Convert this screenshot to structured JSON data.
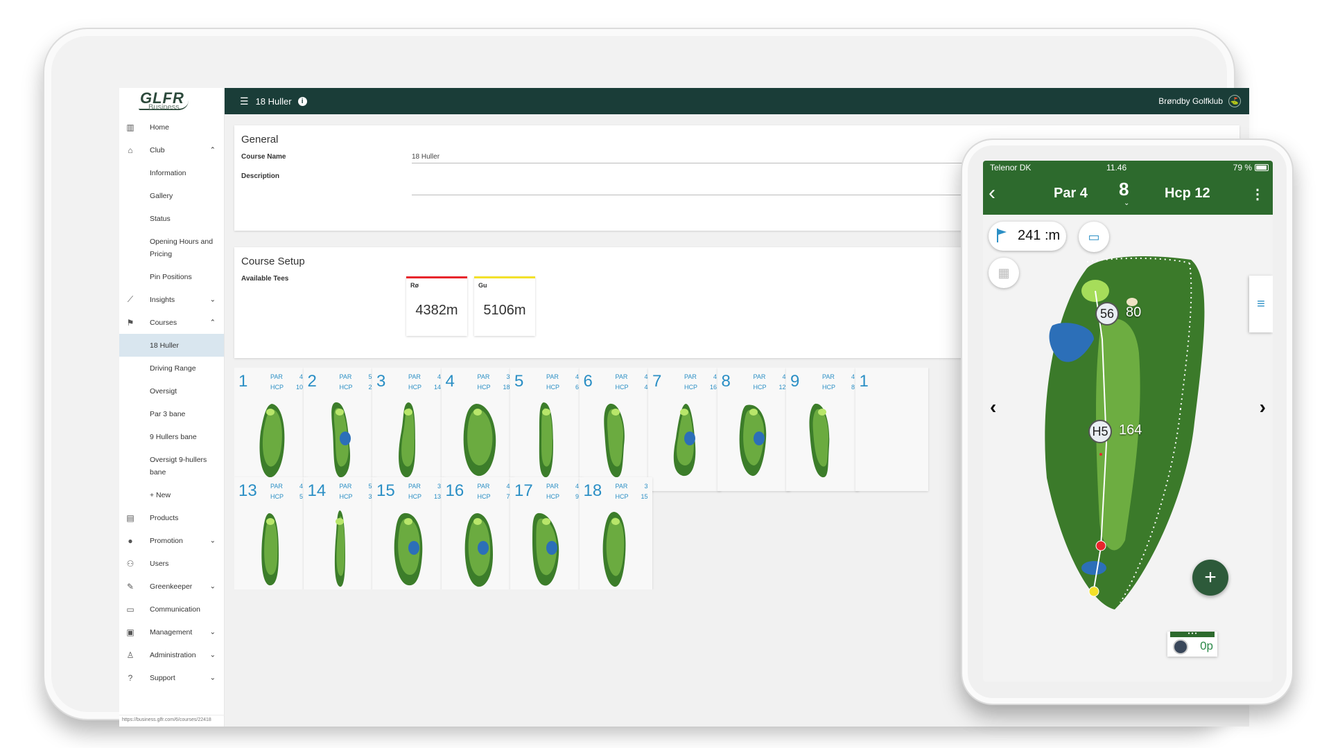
{
  "app": {
    "logo_text": "GLFR",
    "logo_sub": "Business",
    "topbar_title": "18 Huller",
    "club_name": "Brøndby Golfklub",
    "url": "https://business.glfr.com/6/courses/22418"
  },
  "sidebar": {
    "items": [
      {
        "label": "Home",
        "icon": "building-icon",
        "chev": ""
      },
      {
        "label": "Club",
        "icon": "bank-icon",
        "chev": "^"
      },
      {
        "label": "Information",
        "sub": true
      },
      {
        "label": "Gallery",
        "sub": true
      },
      {
        "label": "Status",
        "sub": true
      },
      {
        "label": "Opening Hours and Pricing",
        "sub": true,
        "tall": true
      },
      {
        "label": "Pin Positions",
        "sub": true
      },
      {
        "label": "Insights",
        "icon": "chart-icon",
        "chev": "v"
      },
      {
        "label": "Courses",
        "icon": "golf-flag-icon",
        "chev": "^"
      },
      {
        "label": "18 Huller",
        "sub": true,
        "active": true
      },
      {
        "label": "Driving Range",
        "sub": true
      },
      {
        "label": "Oversigt",
        "sub": true
      },
      {
        "label": "Par 3 bane",
        "sub": true
      },
      {
        "label": "9 Hullers bane",
        "sub": true
      },
      {
        "label": "Oversigt 9-hullers bane",
        "sub": true,
        "tall": true
      },
      {
        "label": "+ New",
        "sub": true
      },
      {
        "label": "Products",
        "icon": "products-icon",
        "chev": ""
      },
      {
        "label": "Promotion",
        "icon": "promotion-icon",
        "chev": "v"
      },
      {
        "label": "Users",
        "icon": "users-icon",
        "chev": ""
      },
      {
        "label": "Greenkeeper",
        "icon": "wrench-icon",
        "chev": "v"
      },
      {
        "label": "Communication",
        "icon": "chat-icon",
        "chev": ""
      },
      {
        "label": "Management",
        "icon": "clipboard-icon",
        "chev": "v"
      },
      {
        "label": "Administration",
        "icon": "person-icon",
        "chev": "v"
      },
      {
        "label": "Support",
        "icon": "help-icon",
        "chev": "v"
      }
    ]
  },
  "general": {
    "heading": "General",
    "course_name_label": "Course Name",
    "course_name_value": "18 Huller",
    "description_label": "Description"
  },
  "setup": {
    "heading": "Course Setup",
    "tees_label": "Available Tees",
    "tees": [
      {
        "name": "Rø",
        "length": "4382m",
        "color": "#e8262c"
      },
      {
        "name": "Gu",
        "length": "5106m",
        "color": "#f3e12a"
      }
    ]
  },
  "holes": {
    "par_label": "PAR",
    "hcp_label": "HCP",
    "list": [
      {
        "no": "1",
        "par": "4",
        "hcp": "10"
      },
      {
        "no": "2",
        "par": "5",
        "hcp": "2"
      },
      {
        "no": "3",
        "par": "4",
        "hcp": "14"
      },
      {
        "no": "4",
        "par": "3",
        "hcp": "18"
      },
      {
        "no": "5",
        "par": "4",
        "hcp": "6"
      },
      {
        "no": "6",
        "par": "4",
        "hcp": "4"
      },
      {
        "no": "7",
        "par": "4",
        "hcp": "16"
      },
      {
        "no": "8",
        "par": "4",
        "hcp": "12"
      },
      {
        "no": "9",
        "par": "4",
        "hcp": "8"
      },
      {
        "no": "1",
        "par": "",
        "hcp": ""
      },
      {
        "no": "13",
        "par": "4",
        "hcp": "5"
      },
      {
        "no": "14",
        "par": "5",
        "hcp": "3"
      },
      {
        "no": "15",
        "par": "3",
        "hcp": "13"
      },
      {
        "no": "16",
        "par": "4",
        "hcp": "7"
      },
      {
        "no": "17",
        "par": "4",
        "hcp": "9"
      },
      {
        "no": "18",
        "par": "3",
        "hcp": "15"
      }
    ]
  },
  "phone": {
    "carrier": "Telenor DK",
    "time": "11.46",
    "battery": "79 %",
    "par": "Par 4",
    "hole": "8",
    "hcp": "Hcp 12",
    "distance": "241",
    "distance_unit": ":m",
    "marker_top": "56",
    "marker_top_dist": "80",
    "marker_mid": "H5",
    "marker_mid_dist": "164",
    "points": "0p",
    "add_label": "+"
  }
}
